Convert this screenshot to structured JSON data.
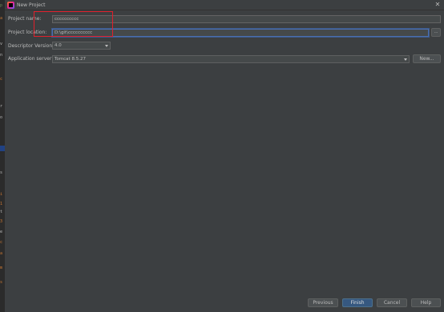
{
  "window": {
    "title": "New Project",
    "close_glyph": "✕"
  },
  "form": {
    "project_name": {
      "label": "Project name:",
      "value": "cccccccccc"
    },
    "project_location": {
      "label": "Project location:",
      "value": "D:\\git\\cccccccccc",
      "browse_label": "..."
    },
    "descriptor_version": {
      "label": "Descriptor Version",
      "value": "4.0"
    },
    "application_server": {
      "label": "Application server:",
      "value": "Tomcat 8.5.27",
      "new_label": "New..."
    }
  },
  "footer": {
    "previous_label": "Previous",
    "finish_label": "Finish",
    "cancel_label": "Cancel",
    "help_label": "Help"
  },
  "colors": {
    "dialog_bg": "#3c3f41",
    "field_bg": "#45494a",
    "focus_border": "#4b6eaf",
    "primary_button": "#365880",
    "annotation": "#e0202c"
  }
}
